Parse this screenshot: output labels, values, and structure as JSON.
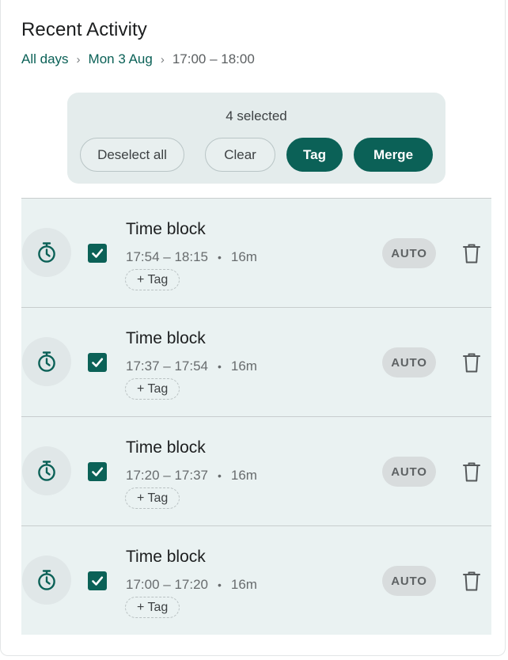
{
  "header": {
    "title": "Recent Activity"
  },
  "breadcrumb": {
    "items": [
      "All days",
      "Mon 3 Aug",
      "17:00 – 18:00"
    ],
    "separator": "›"
  },
  "selection": {
    "count_label": "4 selected",
    "buttons": {
      "deselect_all": "Deselect all",
      "clear": "Clear",
      "tag": "Tag",
      "merge": "Merge"
    }
  },
  "activities": [
    {
      "title": "Time block",
      "range": "17:54 – 18:15",
      "duration": "16m",
      "tag_label": "+ Tag",
      "badge": "AUTO",
      "checked": true
    },
    {
      "title": "Time block",
      "range": "17:37 – 17:54",
      "duration": "16m",
      "tag_label": "+ Tag",
      "badge": "AUTO",
      "checked": true
    },
    {
      "title": "Time block",
      "range": "17:20 – 17:37",
      "duration": "16m",
      "tag_label": "+ Tag",
      "badge": "AUTO",
      "checked": true
    },
    {
      "title": "Time block",
      "range": "17:00 – 17:20",
      "duration": "16m",
      "tag_label": "+ Tag",
      "badge": "AUTO",
      "checked": true
    }
  ],
  "row_separator": "•",
  "icons": {
    "timer": "stopwatch-icon",
    "check": "checkmark-icon",
    "delete": "trash-icon"
  },
  "colors": {
    "accent": "#0b6157",
    "row_background": "#eaf2f2",
    "selection_bar": "#e4ecec",
    "badge_background": "#d8dcdd"
  }
}
